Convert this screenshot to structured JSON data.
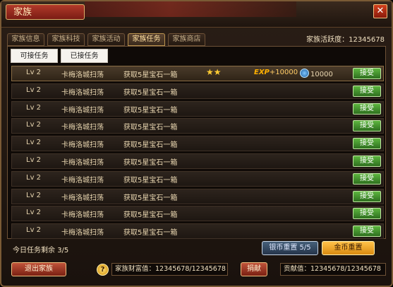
{
  "window": {
    "title": "家族",
    "close_label": "✕"
  },
  "tabs": [
    "家族信息",
    "家族科技",
    "家族活动",
    "家族任务",
    "家族商店"
  ],
  "active_tab_index": 3,
  "activity": {
    "label": "家族活跃度：",
    "value": "12345678"
  },
  "subtabs": [
    "可接任务",
    "已接任务"
  ],
  "tasks": [
    {
      "level": "Lv 2",
      "name": "卡梅洛城扫荡",
      "objective": "获取5星宝石一箱",
      "stars": "★★",
      "exp_label": "EXP",
      "exp_value": "+10000",
      "coin_value": "10000",
      "button": "接受"
    },
    {
      "level": "Lv 2",
      "name": "卡梅洛城扫荡",
      "objective": "获取5星宝石一箱",
      "button": "接受"
    },
    {
      "level": "Lv 2",
      "name": "卡梅洛城扫荡",
      "objective": "获取5星宝石一箱",
      "button": "接受"
    },
    {
      "level": "Lv 2",
      "name": "卡梅洛城扫荡",
      "objective": "获取5星宝石一箱",
      "button": "接受"
    },
    {
      "level": "Lv 2",
      "name": "卡梅洛城扫荡",
      "objective": "获取5星宝石一箱",
      "button": "接受"
    },
    {
      "level": "Lv 2",
      "name": "卡梅洛城扫荡",
      "objective": "获取5星宝石一箱",
      "button": "接受"
    },
    {
      "level": "Lv 2",
      "name": "卡梅洛城扫荡",
      "objective": "获取5星宝石一箱",
      "button": "接受"
    },
    {
      "level": "Lv 2",
      "name": "卡梅洛城扫荡",
      "objective": "获取5星宝石一箱",
      "button": "接受"
    },
    {
      "level": "Lv 2",
      "name": "卡梅洛城扫荡",
      "objective": "获取5星宝石一箱",
      "button": "接受"
    },
    {
      "level": "Lv 2",
      "name": "卡梅洛城扫荡",
      "objective": "获取5星宝石一箱",
      "button": "接受"
    }
  ],
  "remaining": {
    "label": "今日任务剩余",
    "value": "3/5"
  },
  "reset": {
    "silver_label": "银币重置",
    "silver_count": "5/5",
    "gold_label": "金币重置"
  },
  "footer": {
    "exit_label": "退出家族",
    "help_label": "?",
    "wealth_label": "家族财富值：",
    "wealth_value": "12345678/12345678",
    "donate_label": "捐献",
    "contrib_label": "贡献值：",
    "contrib_value": "12345678/12345678"
  },
  "colors": {
    "accent_gold": "#ffcc33",
    "accept_green": "#5db63f",
    "title_red": "#b23a2a"
  },
  "icons": {
    "close": "close-icon",
    "star": "star-icon",
    "coin": "coin-icon",
    "help": "help-icon"
  }
}
